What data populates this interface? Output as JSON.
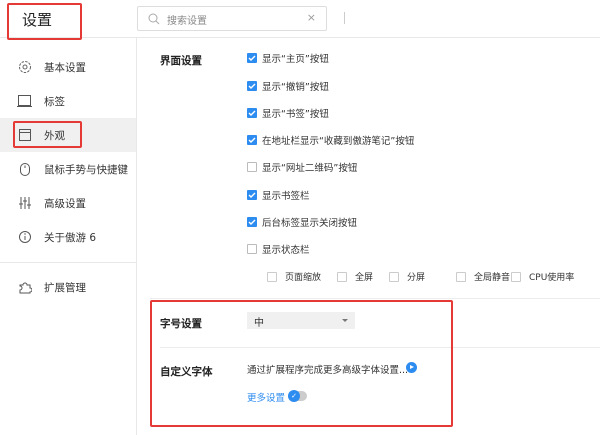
{
  "header": {
    "title": "设置",
    "search_placeholder": "搜索设置",
    "clear": "×"
  },
  "sidebar": {
    "items": [
      {
        "label": "基本设置",
        "icon": "gear-icon"
      },
      {
        "label": "标签",
        "icon": "tab-icon"
      },
      {
        "label": "外观",
        "icon": "window-icon",
        "active": true
      },
      {
        "label": "鼠标手势与快捷键",
        "icon": "mouse-icon"
      },
      {
        "label": "高级设置",
        "icon": "sliders-icon"
      },
      {
        "label": "关于傲游 6",
        "icon": "info-icon"
      },
      {
        "label": "扩展管理",
        "icon": "puzzle-icon"
      }
    ]
  },
  "appearance": {
    "section_label": "界面设置",
    "options": [
      {
        "label": "显示“主页”按钮",
        "checked": true
      },
      {
        "label": "显示“撤销”按钮",
        "checked": true
      },
      {
        "label": "显示“书签”按钮",
        "checked": true
      },
      {
        "label": "在地址栏显示“收藏到傲游笔记”按钮",
        "checked": true
      },
      {
        "label": "显示“网址二维码”按钮",
        "checked": false
      },
      {
        "label": "显示书签栏",
        "checked": true
      },
      {
        "label": "后台标签显示关闭按钮",
        "checked": true
      },
      {
        "label": "显示状态栏",
        "checked": false
      }
    ],
    "status_bar_options": [
      {
        "label": "页面缩放",
        "checked": false
      },
      {
        "label": "全屏",
        "checked": false
      },
      {
        "label": "分屏",
        "checked": false
      },
      {
        "label": "全局静音",
        "checked": false
      },
      {
        "label": "CPU使用率",
        "checked": false
      }
    ]
  },
  "font": {
    "size_label": "字号设置",
    "size_value": "中",
    "custom_label": "自定义字体",
    "custom_desc": "通过扩展程序完成更多高级字体设置...",
    "more_settings": "更多设置"
  },
  "colors": {
    "accent": "#2d8cf0",
    "annotation": "#e53935"
  }
}
